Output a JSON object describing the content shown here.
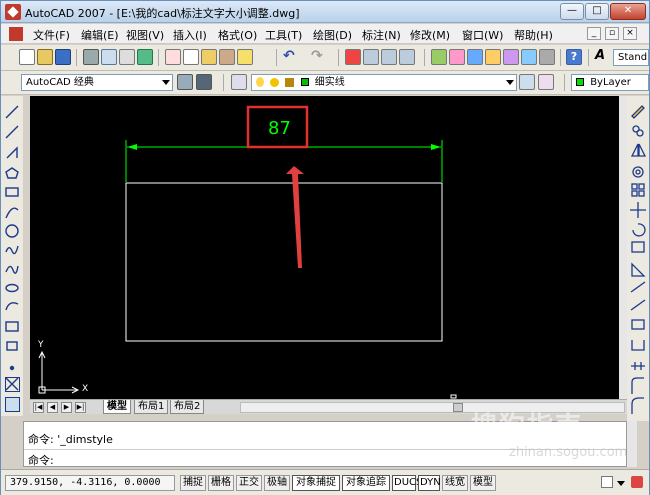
{
  "window": {
    "title": "AutoCAD 2007 - [E:\\我的cad\\标注文字大小调整.dwg]",
    "min_glyph": "—",
    "max_glyph": "□",
    "close_glyph": "✕"
  },
  "menu": {
    "items": [
      "文件(F)",
      "编辑(E)",
      "视图(V)",
      "插入(I)",
      "格式(O)",
      "工具(T)",
      "绘图(D)",
      "标注(N)",
      "修改(M)",
      "窗口(W)",
      "帮助(H)"
    ],
    "doc_min": "_",
    "doc_restore": "▫",
    "doc_close": "×"
  },
  "toolbar": {
    "text_style": "Stand"
  },
  "workspace": {
    "selected": "AutoCAD 经典"
  },
  "layer": {
    "selected": "细实线"
  },
  "color": {
    "selected": "ByLayer"
  },
  "drawing": {
    "dimension_text": "87",
    "ucs_x": "X",
    "ucs_y": "Y",
    "colors": {
      "background": "#000000",
      "dimension": "#00ff00",
      "geometry": "#ffffff",
      "highlight_box": "#e03030",
      "arrow": "#e04040"
    }
  },
  "layout_tabs": [
    "模型",
    "布局1",
    "布局2"
  ],
  "nav_glyphs": [
    "|◀",
    "◀",
    "▶",
    "▶|"
  ],
  "command": {
    "line1": "命令: '_dimstyle",
    "line2": "命令:"
  },
  "status": {
    "coordinates": "379.9150, -4.3116, 0.0000",
    "buttons": [
      "捕捉",
      "栅格",
      "正交",
      "极轴",
      "对象捕捉",
      "对象追踪",
      "DUCS",
      "DYN",
      "线宽",
      "模型"
    ],
    "active": [
      "对象捕捉",
      "对象追踪",
      "DUCS",
      "DYN"
    ]
  },
  "watermark": {
    "brand": "搜狗指南",
    "url": "zhinan.sogou.com"
  }
}
